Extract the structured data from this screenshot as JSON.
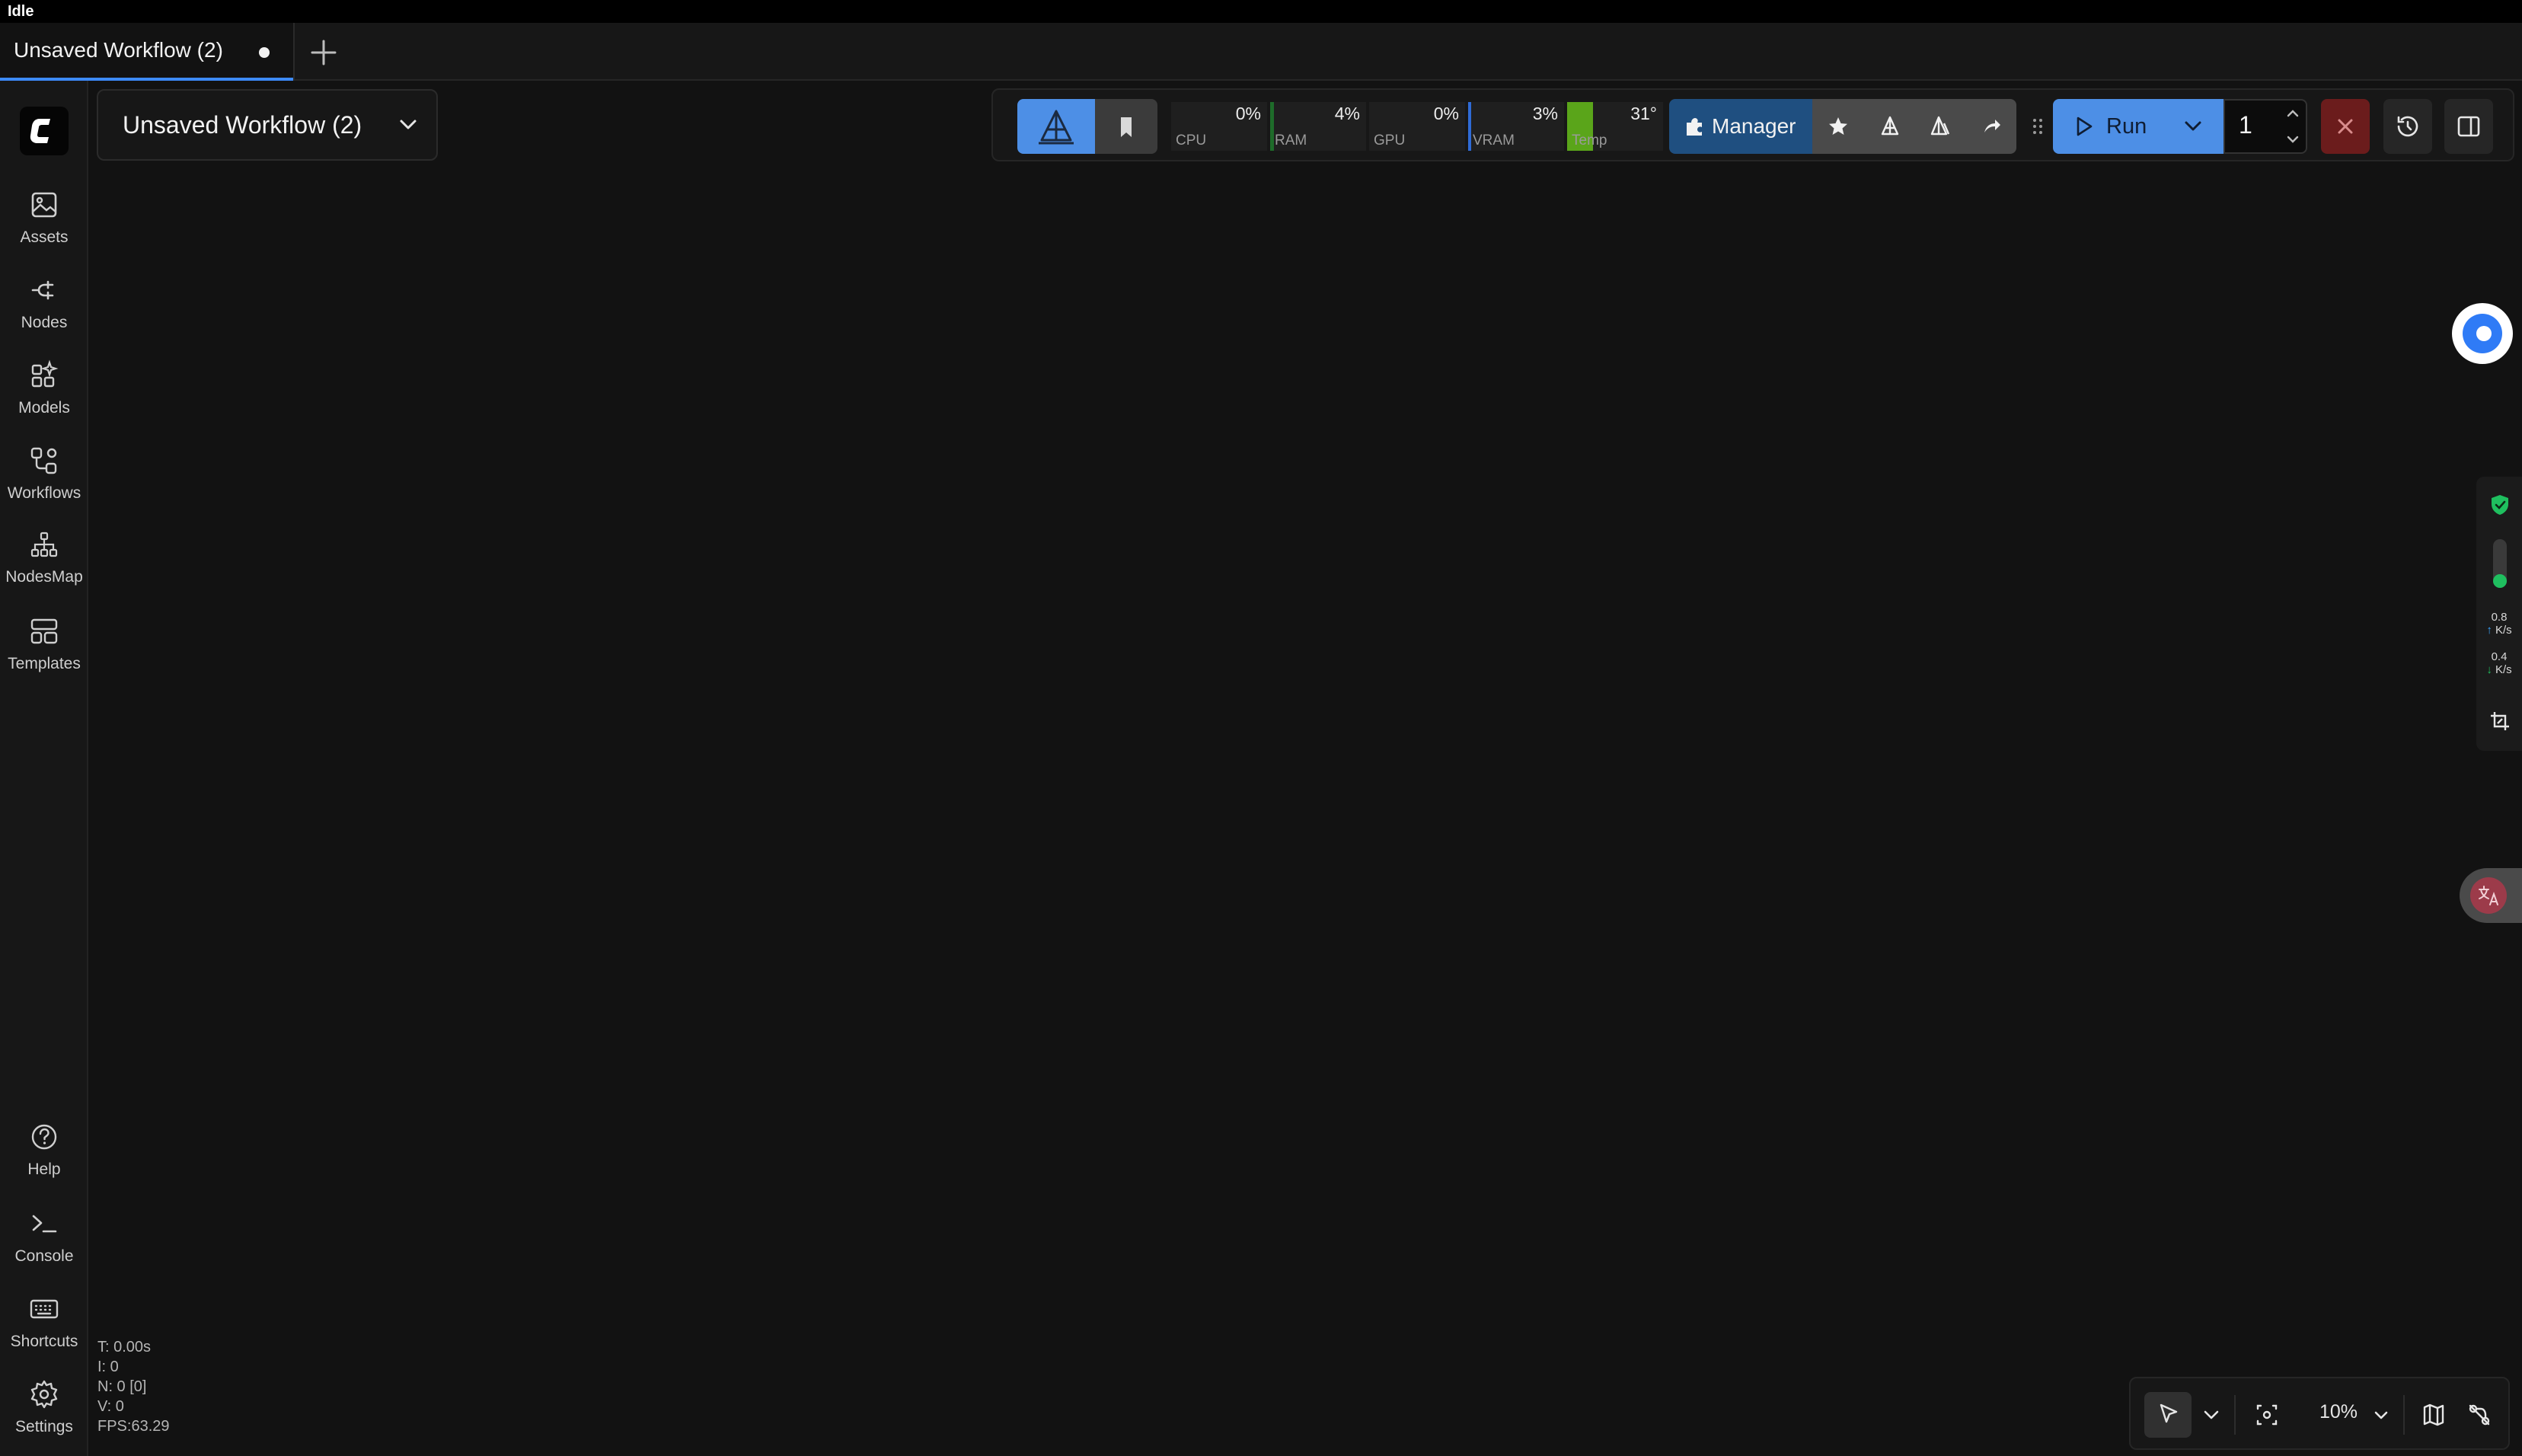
{
  "status": {
    "label": "Idle"
  },
  "tabs": [
    {
      "title": "Unsaved Workflow (2)",
      "modified": true
    }
  ],
  "sidebar": {
    "top_items": [
      {
        "label": "Assets",
        "icon": "image-icon"
      },
      {
        "label": "Nodes",
        "icon": "plug-icon"
      },
      {
        "label": "Models",
        "icon": "grid-sparkle-icon"
      },
      {
        "label": "Workflows",
        "icon": "workflow-icon"
      },
      {
        "label": "NodesMap",
        "icon": "sitemap-icon"
      },
      {
        "label": "Templates",
        "icon": "template-icon"
      }
    ],
    "bottom_items": [
      {
        "label": "Help",
        "icon": "help-icon"
      },
      {
        "label": "Console",
        "icon": "terminal-icon"
      },
      {
        "label": "Shortcuts",
        "icon": "keyboard-icon"
      },
      {
        "label": "Settings",
        "icon": "gear-icon"
      }
    ]
  },
  "stats": {
    "t": "T: 0.00s",
    "i": "I: 0",
    "n": "N: 0 [0]",
    "v": "V: 0",
    "fps": "FPS:63.29"
  },
  "workflow_selector": {
    "label": "Unsaved Workflow (2)"
  },
  "monitor": {
    "cpu": {
      "name": "CPU",
      "value": "0%",
      "level": 0.0
    },
    "ram": {
      "name": "RAM",
      "value": "4%",
      "level": 0.04
    },
    "gpu": {
      "name": "GPU",
      "value": "0%",
      "level": 0.0
    },
    "vram": {
      "name": "VRAM",
      "value": "3%",
      "level": 0.03
    },
    "temp": {
      "name": "Temp",
      "value": "31°",
      "level": 0.31
    }
  },
  "toolbar": {
    "manager_label": "Manager",
    "run_label": "Run",
    "batch_count": "1"
  },
  "side_monitor": {
    "upload": "0.8",
    "upload_unit": "K/s",
    "download": "0.4",
    "download_unit": "K/s"
  },
  "canvas_controls": {
    "zoom": "10%"
  },
  "colors": {
    "accent": "#4d8fe6",
    "manager": "#1f4f80",
    "stop": "#6b1c1c",
    "ram_bar": "#1e6b2a",
    "vram_bar": "#2f6bd6",
    "temp_bar": "#5aa51a",
    "online": "#1fbf5f"
  }
}
